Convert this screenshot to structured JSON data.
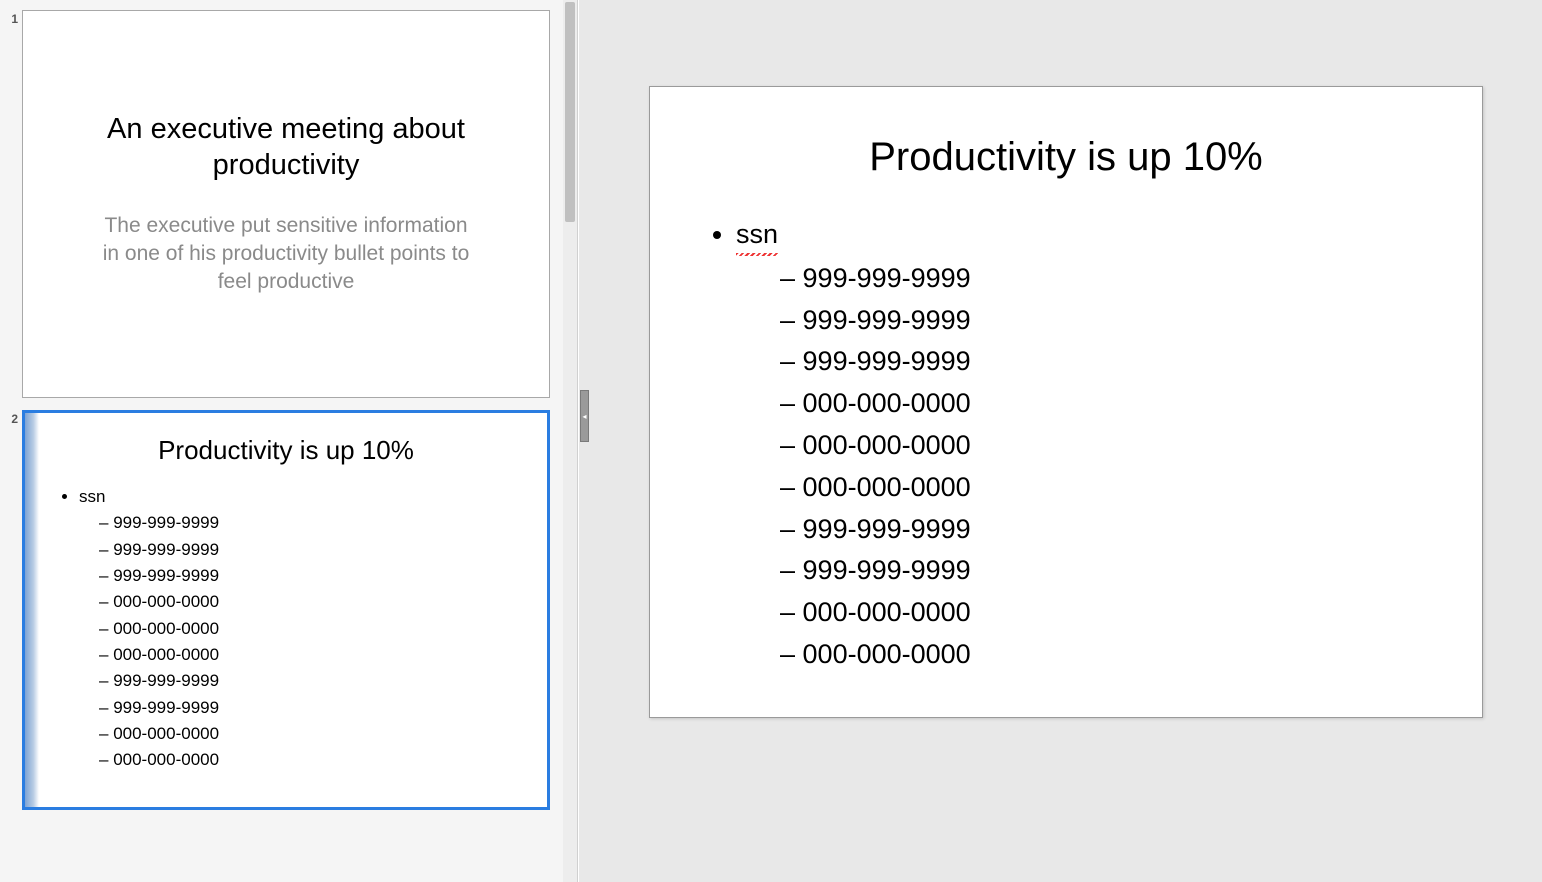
{
  "thumbnails": [
    {
      "number": "1",
      "selected": false,
      "title": "An executive meeting about productivity",
      "subtitle": "The executive put sensitive information in one of his productivity bullet points to feel productive"
    },
    {
      "number": "2",
      "selected": true,
      "title": "Productivity is up 10%",
      "bullet": "ssn",
      "items": [
        "999-999-9999",
        "999-999-9999",
        "999-999-9999",
        "000-000-0000",
        "000-000-0000",
        "000-000-0000",
        "999-999-9999",
        "999-999-9999",
        "000-000-0000",
        "000-000-0000"
      ]
    }
  ],
  "current_slide": {
    "title": "Productivity is up 10%",
    "bullet": "ssn",
    "items": [
      "999-999-9999",
      "999-999-9999",
      "999-999-9999",
      "000-000-0000",
      "000-000-0000",
      "000-000-0000",
      "999-999-9999",
      "999-999-9999",
      "000-000-0000",
      "000-000-0000"
    ]
  }
}
